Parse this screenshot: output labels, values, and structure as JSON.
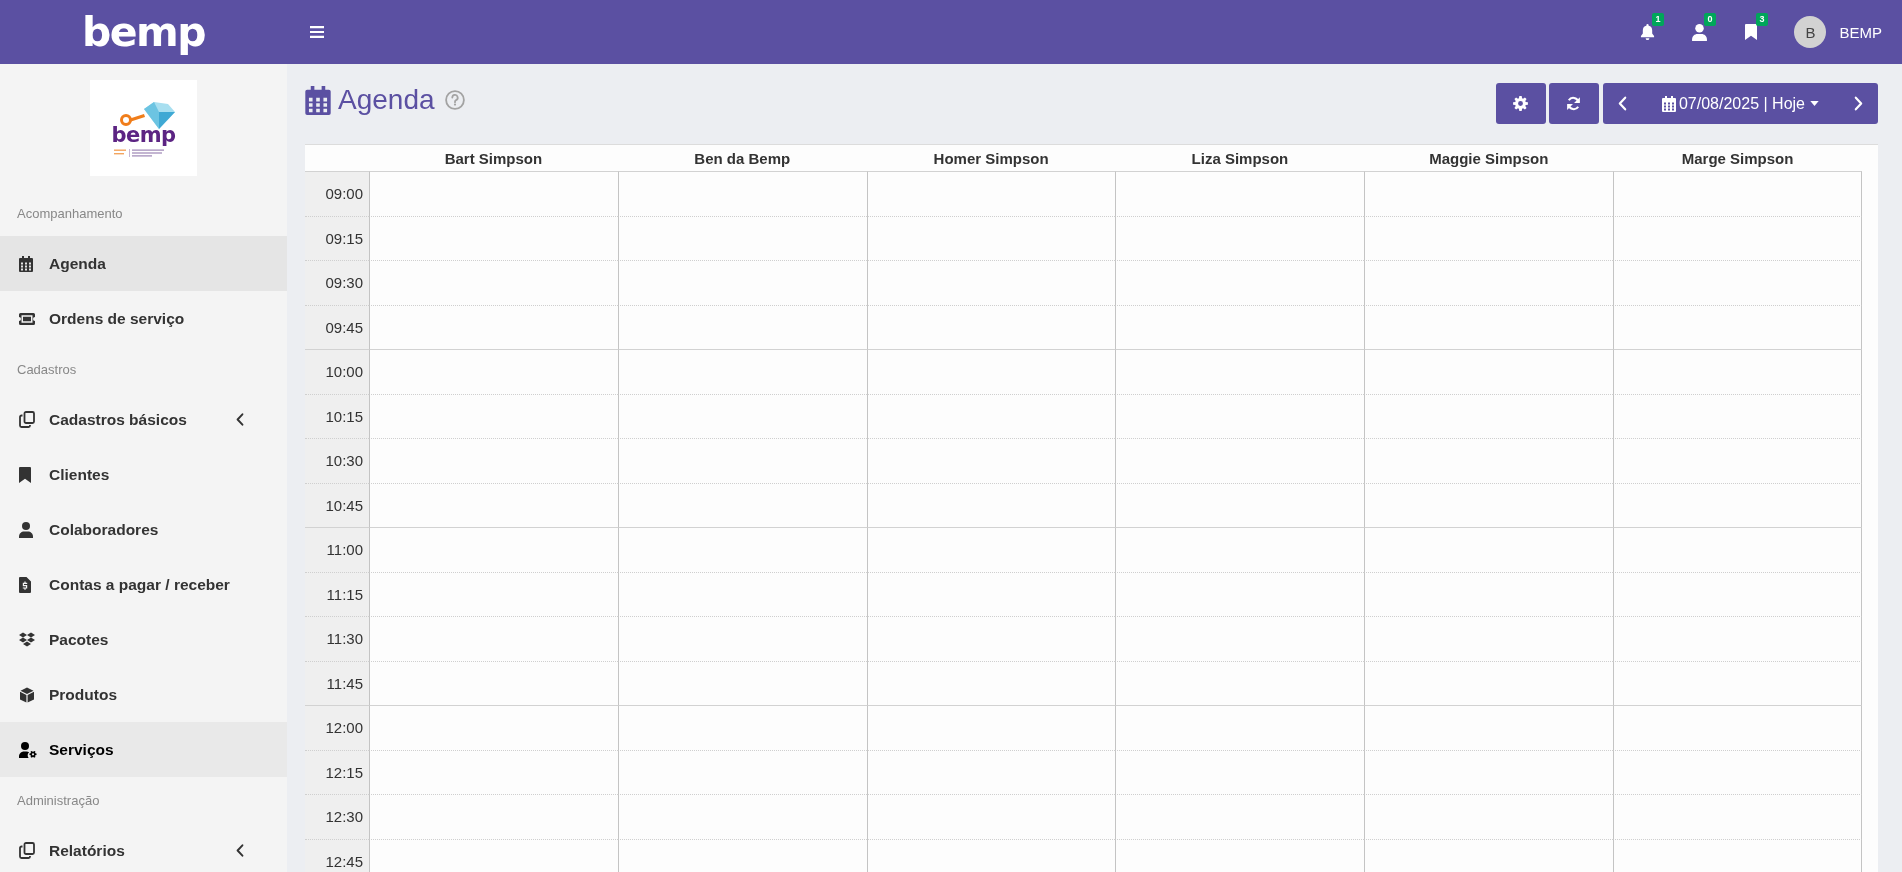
{
  "topbar": {
    "logo": "bemp",
    "notifications": [
      {
        "count": "1"
      },
      {
        "count": "0"
      },
      {
        "count": "3"
      }
    ],
    "user": {
      "initial": "B",
      "name": "BEMP"
    }
  },
  "sidebar": {
    "logo": {
      "text": "bemp"
    },
    "sections": [
      {
        "title": "Acompanhamento",
        "items": [
          {
            "label": "Agenda",
            "kind": "link",
            "selected": true,
            "hovered": false
          },
          {
            "label": "Ordens de serviço",
            "kind": "link",
            "selected": false,
            "hovered": false
          }
        ]
      },
      {
        "title": "Cadastros",
        "items": [
          {
            "label": "Cadastros básicos",
            "kind": "group",
            "expanded": false,
            "selected": false,
            "hovered": false
          },
          {
            "label": "Clientes",
            "kind": "link",
            "selected": false,
            "hovered": false
          },
          {
            "label": "Colaboradores",
            "kind": "link",
            "selected": false,
            "hovered": false
          },
          {
            "label": "Contas a pagar / receber",
            "kind": "link",
            "selected": false,
            "hovered": false
          },
          {
            "label": "Pacotes",
            "kind": "link",
            "selected": false,
            "hovered": false
          },
          {
            "label": "Produtos",
            "kind": "link",
            "selected": false,
            "hovered": false
          },
          {
            "label": "Serviços",
            "kind": "link",
            "selected": false,
            "hovered": true
          }
        ]
      },
      {
        "title": "Administração",
        "items": [
          {
            "label": "Relatórios",
            "kind": "group",
            "expanded": false,
            "selected": false,
            "hovered": false
          }
        ]
      }
    ]
  },
  "page": {
    "title": "Agenda",
    "toolbar": {
      "date_label": "07/08/2025 | Hoje"
    }
  },
  "calendar": {
    "columns": [
      "Bart Simpson",
      "Ben da Bemp",
      "Homer Simpson",
      "Liza Simpson",
      "Maggie Simpson",
      "Marge Simpson"
    ],
    "rows": [
      {
        "time": "09:00",
        "kind": "hour"
      },
      {
        "time": "09:15",
        "kind": "quarter"
      },
      {
        "time": "09:30",
        "kind": "quarter"
      },
      {
        "time": "09:45",
        "kind": "quarter"
      },
      {
        "time": "10:00",
        "kind": "hour"
      },
      {
        "time": "10:15",
        "kind": "quarter"
      },
      {
        "time": "10:30",
        "kind": "quarter"
      },
      {
        "time": "10:45",
        "kind": "quarter"
      },
      {
        "time": "11:00",
        "kind": "hour"
      },
      {
        "time": "11:15",
        "kind": "quarter"
      },
      {
        "time": "11:30",
        "kind": "quarter"
      },
      {
        "time": "11:45",
        "kind": "quarter"
      },
      {
        "time": "12:00",
        "kind": "hour"
      },
      {
        "time": "12:15",
        "kind": "quarter"
      },
      {
        "time": "12:30",
        "kind": "quarter"
      },
      {
        "time": "12:45",
        "kind": "quarter"
      }
    ]
  }
}
